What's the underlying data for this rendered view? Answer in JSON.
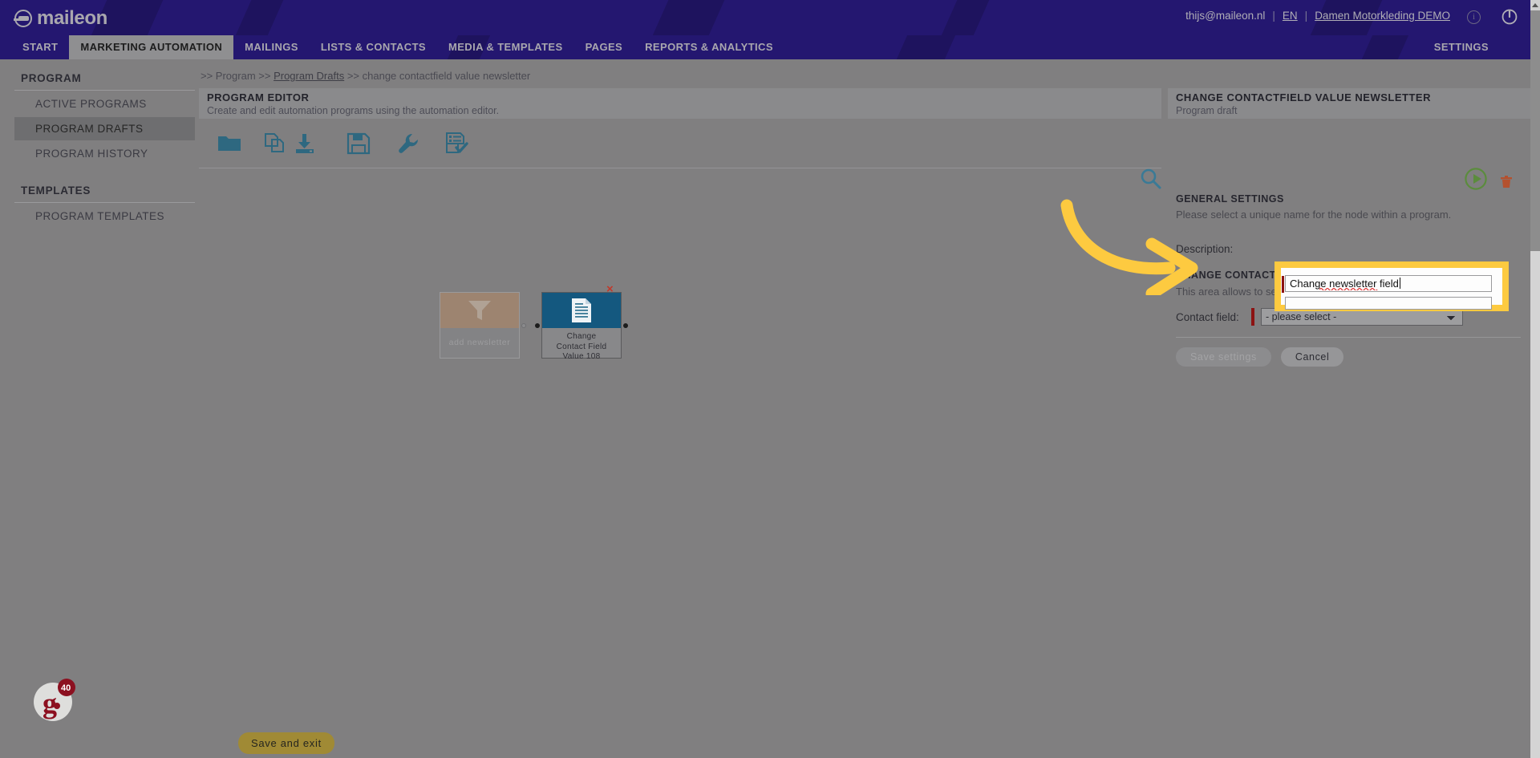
{
  "header": {
    "logo_text": "maileon",
    "user_email": "thijs@maileon.nl",
    "separator": "|",
    "language": "EN",
    "account": "Damen Motorkleding DEMO",
    "info_icon": "i",
    "power_icon": "power-icon"
  },
  "nav": {
    "items": [
      {
        "label": "START",
        "active": false
      },
      {
        "label": "MARKETING AUTOMATION",
        "active": true
      },
      {
        "label": "MAILINGS",
        "active": false
      },
      {
        "label": "LISTS & CONTACTS",
        "active": false
      },
      {
        "label": "MEDIA & TEMPLATES",
        "active": false
      },
      {
        "label": "PAGES",
        "active": false
      },
      {
        "label": "REPORTS & ANALYTICS",
        "active": false
      }
    ],
    "settings_label": "SETTINGS"
  },
  "sidebar": {
    "groups": [
      {
        "title": "PROGRAM",
        "items": [
          {
            "label": "ACTIVE PROGRAMS",
            "active": false
          },
          {
            "label": "PROGRAM DRAFTS",
            "active": true
          },
          {
            "label": "PROGRAM HISTORY",
            "active": false
          }
        ]
      },
      {
        "title": "TEMPLATES",
        "items": [
          {
            "label": "PROGRAM TEMPLATES",
            "active": false
          }
        ]
      }
    ]
  },
  "breadcrumb": {
    "prefix1": ">> ",
    "item1": "Program",
    "prefix2": " >> ",
    "item2": "Program Drafts",
    "prefix3": " >> ",
    "item3": "change contactfield value newsletter"
  },
  "editor_panel": {
    "title": "PROGRAM EDITOR",
    "subtitle": "Create and edit automation programs using the automation editor."
  },
  "right_panel": {
    "title": "CHANGE CONTACTFIELD VALUE NEWSLETTER",
    "subtitle": "Program draft"
  },
  "toolbar": {
    "icons": [
      {
        "name": "open-folder-icon",
        "title": "Open"
      },
      {
        "name": "copy-icon",
        "title": "Copy"
      },
      {
        "name": "import-download-icon",
        "title": "Import"
      },
      {
        "name": "save-disk-icon",
        "title": "Save"
      },
      {
        "name": "wrench-tools-icon",
        "title": "Tools"
      },
      {
        "name": "validate-checklist-icon",
        "title": "Validate"
      }
    ],
    "search_icon": "search-icon",
    "play_icon": "play-icon"
  },
  "canvas": {
    "nodes": [
      {
        "id": "add-newsletter",
        "label": "add newsletter",
        "icon": "funnel-icon",
        "state": "placeholder"
      },
      {
        "id": "change-contact-field-value",
        "label": "Change\nContact Field\nValue 108",
        "label_line1": "Change",
        "label_line2": "Contact Field",
        "label_line3": "Value 108",
        "icon": "document-lines-icon",
        "state": "selected"
      }
    ],
    "close_icon": "×"
  },
  "settings": {
    "delete_icon": "trash-icon",
    "general_title": "GENERAL SETTINGS",
    "general_desc": "Please select a unique name for the node within a program.",
    "name_value": "Change newsletter field",
    "description_label": "Description:",
    "cfv_title": "CHANGE CONTACT FIELD VALUE",
    "cfv_desc": "This area allows to select the contact field and the new value.",
    "contact_field_label": "Contact field:",
    "contact_field_value": "- please select -",
    "contact_field_options": [
      "- please select -"
    ],
    "save_label": "Save settings",
    "cancel_label": "Cancel"
  },
  "footer": {
    "badge_letter": "g.",
    "badge_count": "40",
    "save_and_exit": "Save and exit"
  },
  "colors": {
    "brand_purple": "#241770",
    "accent_yellow": "#fdca40",
    "node_blue": "#14587f",
    "play_green": "#5b8c3d",
    "required_red": "#8c1212",
    "save_exit_gold": "#a08a35"
  }
}
